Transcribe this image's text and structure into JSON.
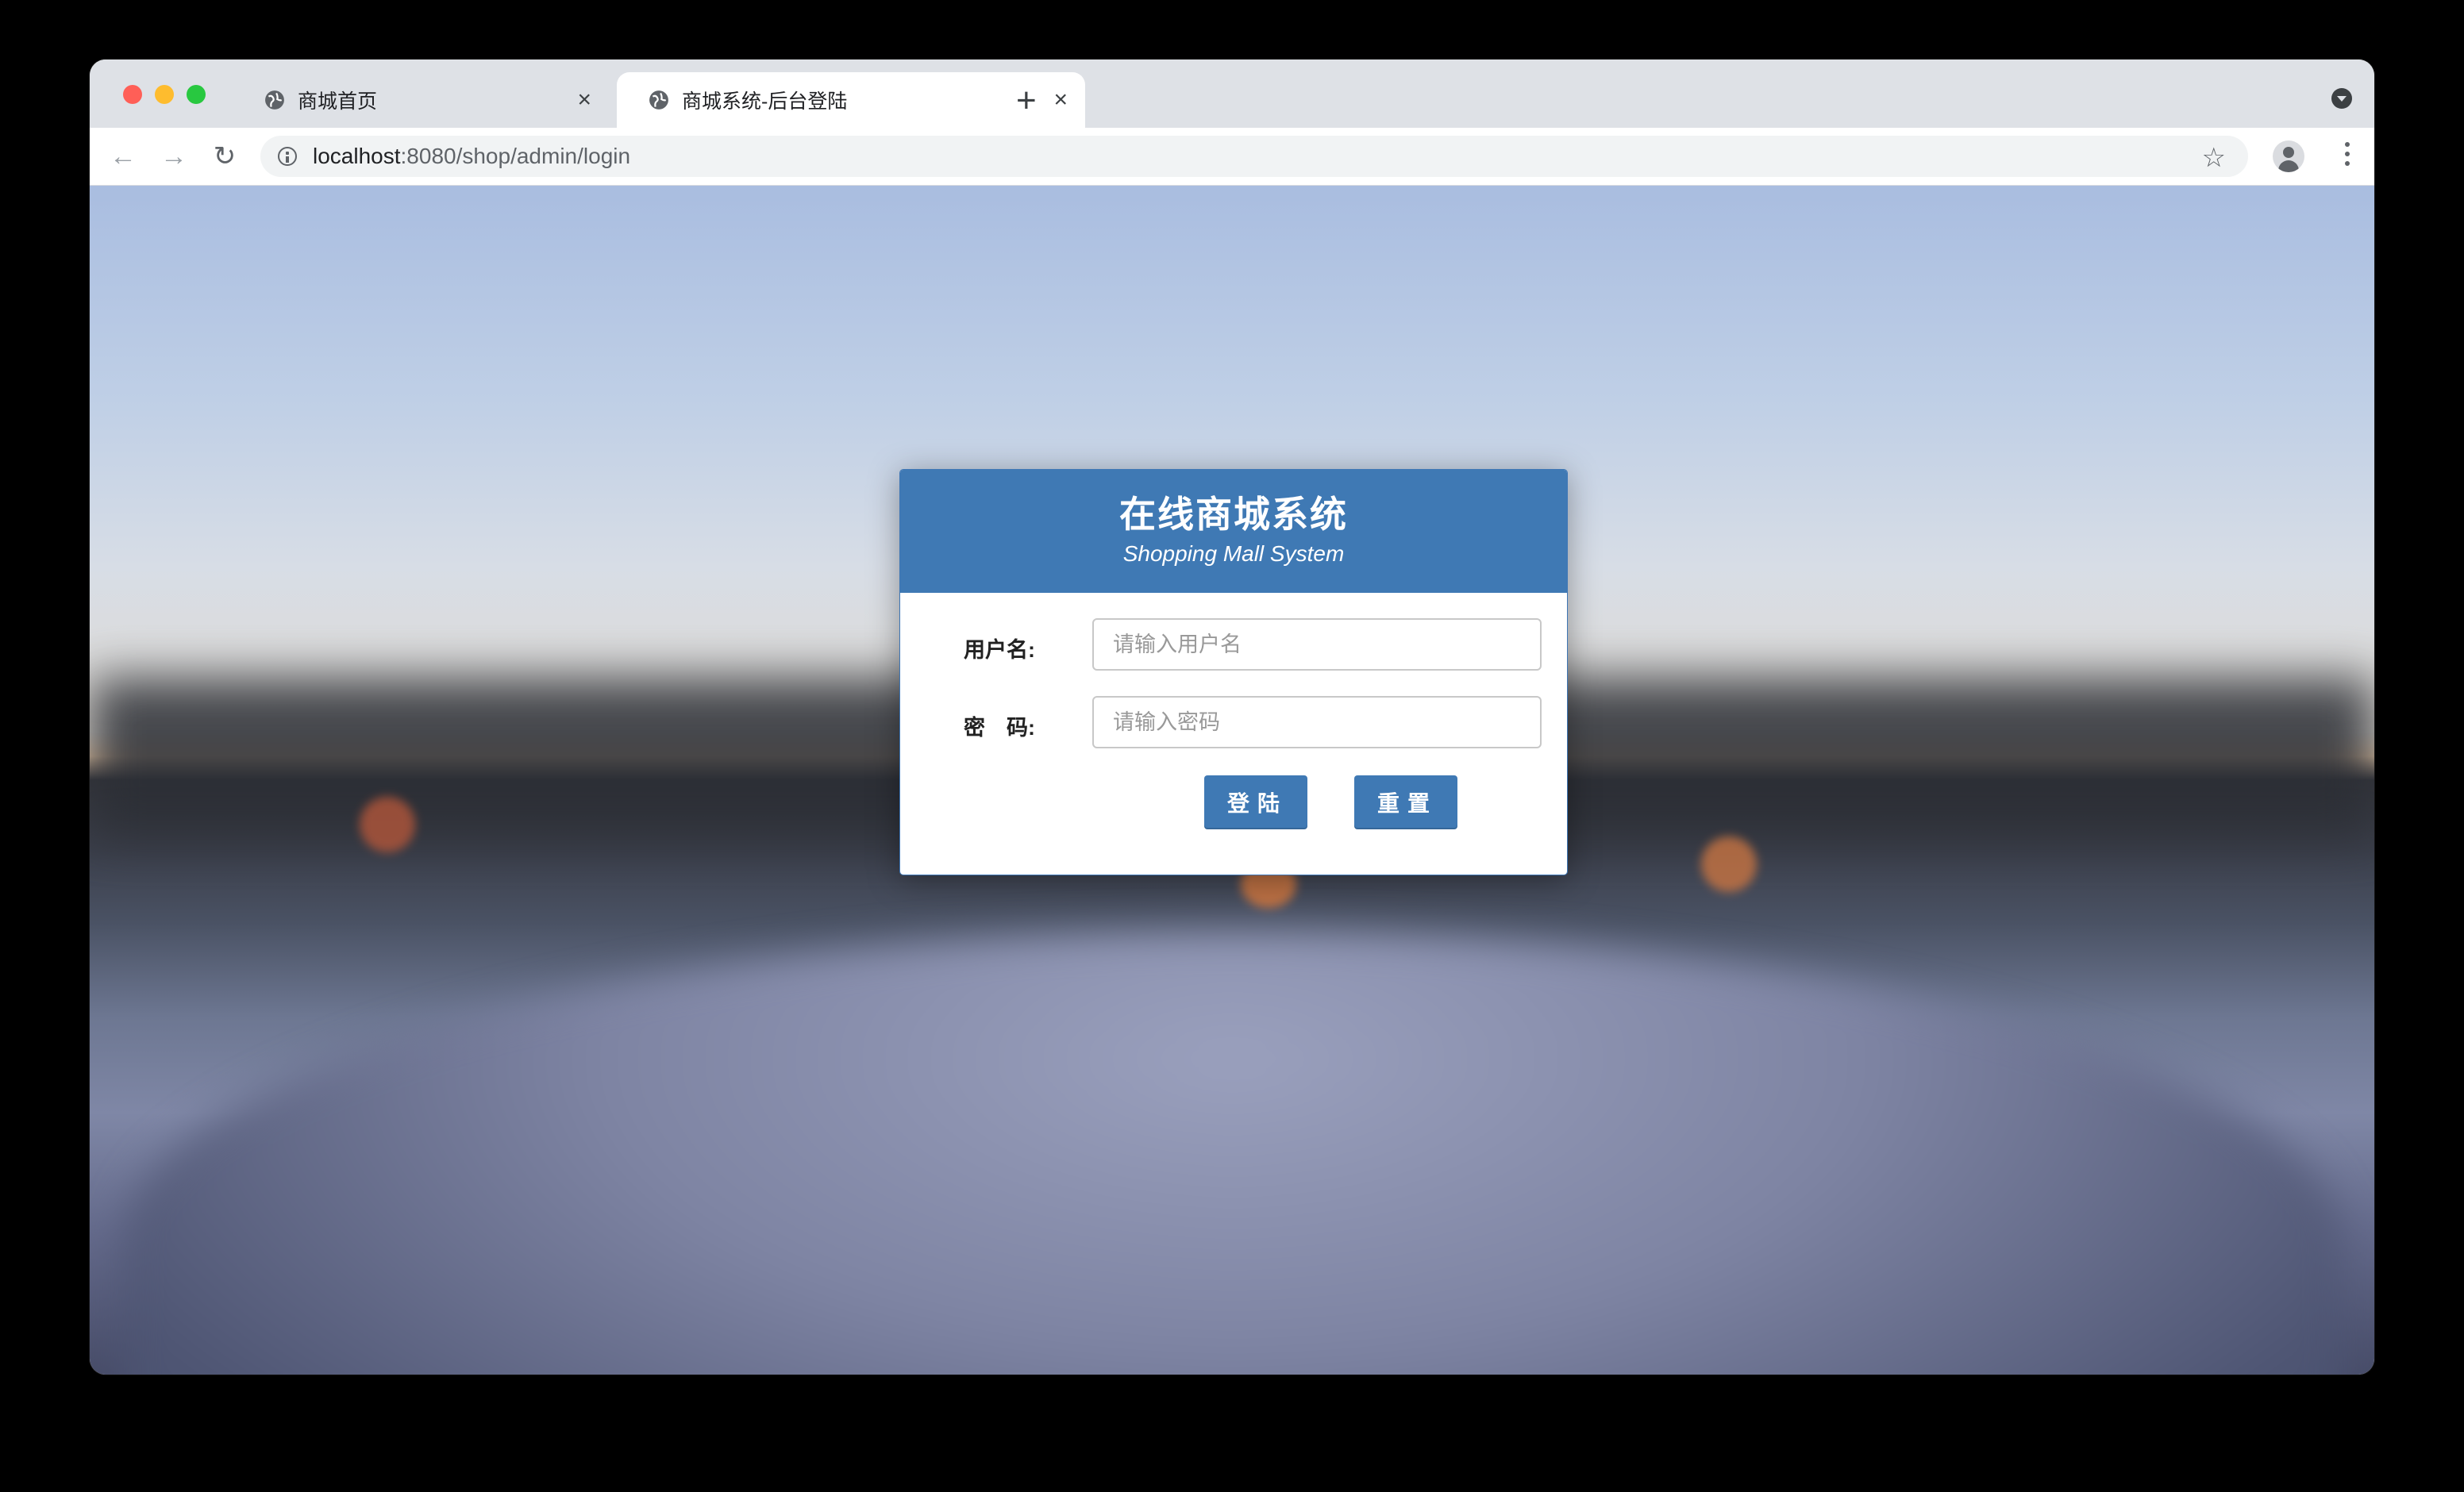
{
  "browser": {
    "tabs": [
      {
        "label": "商城首页",
        "icon": "globe-icon",
        "active": false
      },
      {
        "label": "商城系统-后台登陆",
        "icon": "globe-icon",
        "active": true
      }
    ],
    "url": {
      "host": "localhost",
      "path": ":8080/shop/admin/login"
    },
    "close_glyph": "×",
    "new_tab_glyph": "+",
    "back_glyph": "←",
    "forward_glyph": "→",
    "reload_glyph": "↻",
    "star_glyph": "☆"
  },
  "login": {
    "title": "在线商城系统",
    "subtitle": "Shopping Mall System",
    "username_label": "用户名:",
    "username_placeholder": "请输入用户名",
    "password_label": "密　码:",
    "password_placeholder": "请输入密码",
    "login_button": "登陆",
    "reset_button": "重置"
  },
  "colors": {
    "header": "#3f79b4",
    "button": "#3f79b4"
  }
}
